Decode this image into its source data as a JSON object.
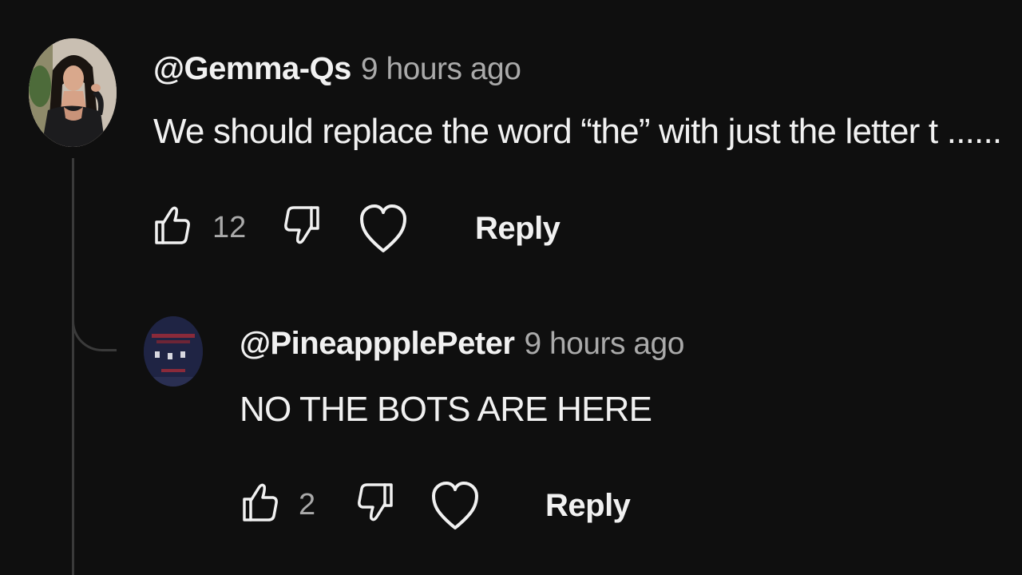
{
  "colors": {
    "background": "#0f0f0f",
    "primary_text": "#f1f1f1",
    "secondary_text": "#aaaaaa",
    "thread_line": "#3a3a3a"
  },
  "comment": {
    "author": "@Gemma-Qs",
    "time": "9 hours ago",
    "text": "We should replace the word “the” with just the letter t ......",
    "likes": "12",
    "reply_label": "Reply",
    "icons": [
      "thumbs-up-icon",
      "thumbs-down-icon",
      "heart-icon"
    ]
  },
  "reply": {
    "author": "@PineappplePeter",
    "time": "9 hours ago",
    "text": "NO THE BOTS ARE HERE",
    "likes": "2",
    "reply_label": "Reply",
    "icons": [
      "thumbs-up-icon",
      "thumbs-down-icon",
      "heart-icon"
    ]
  }
}
